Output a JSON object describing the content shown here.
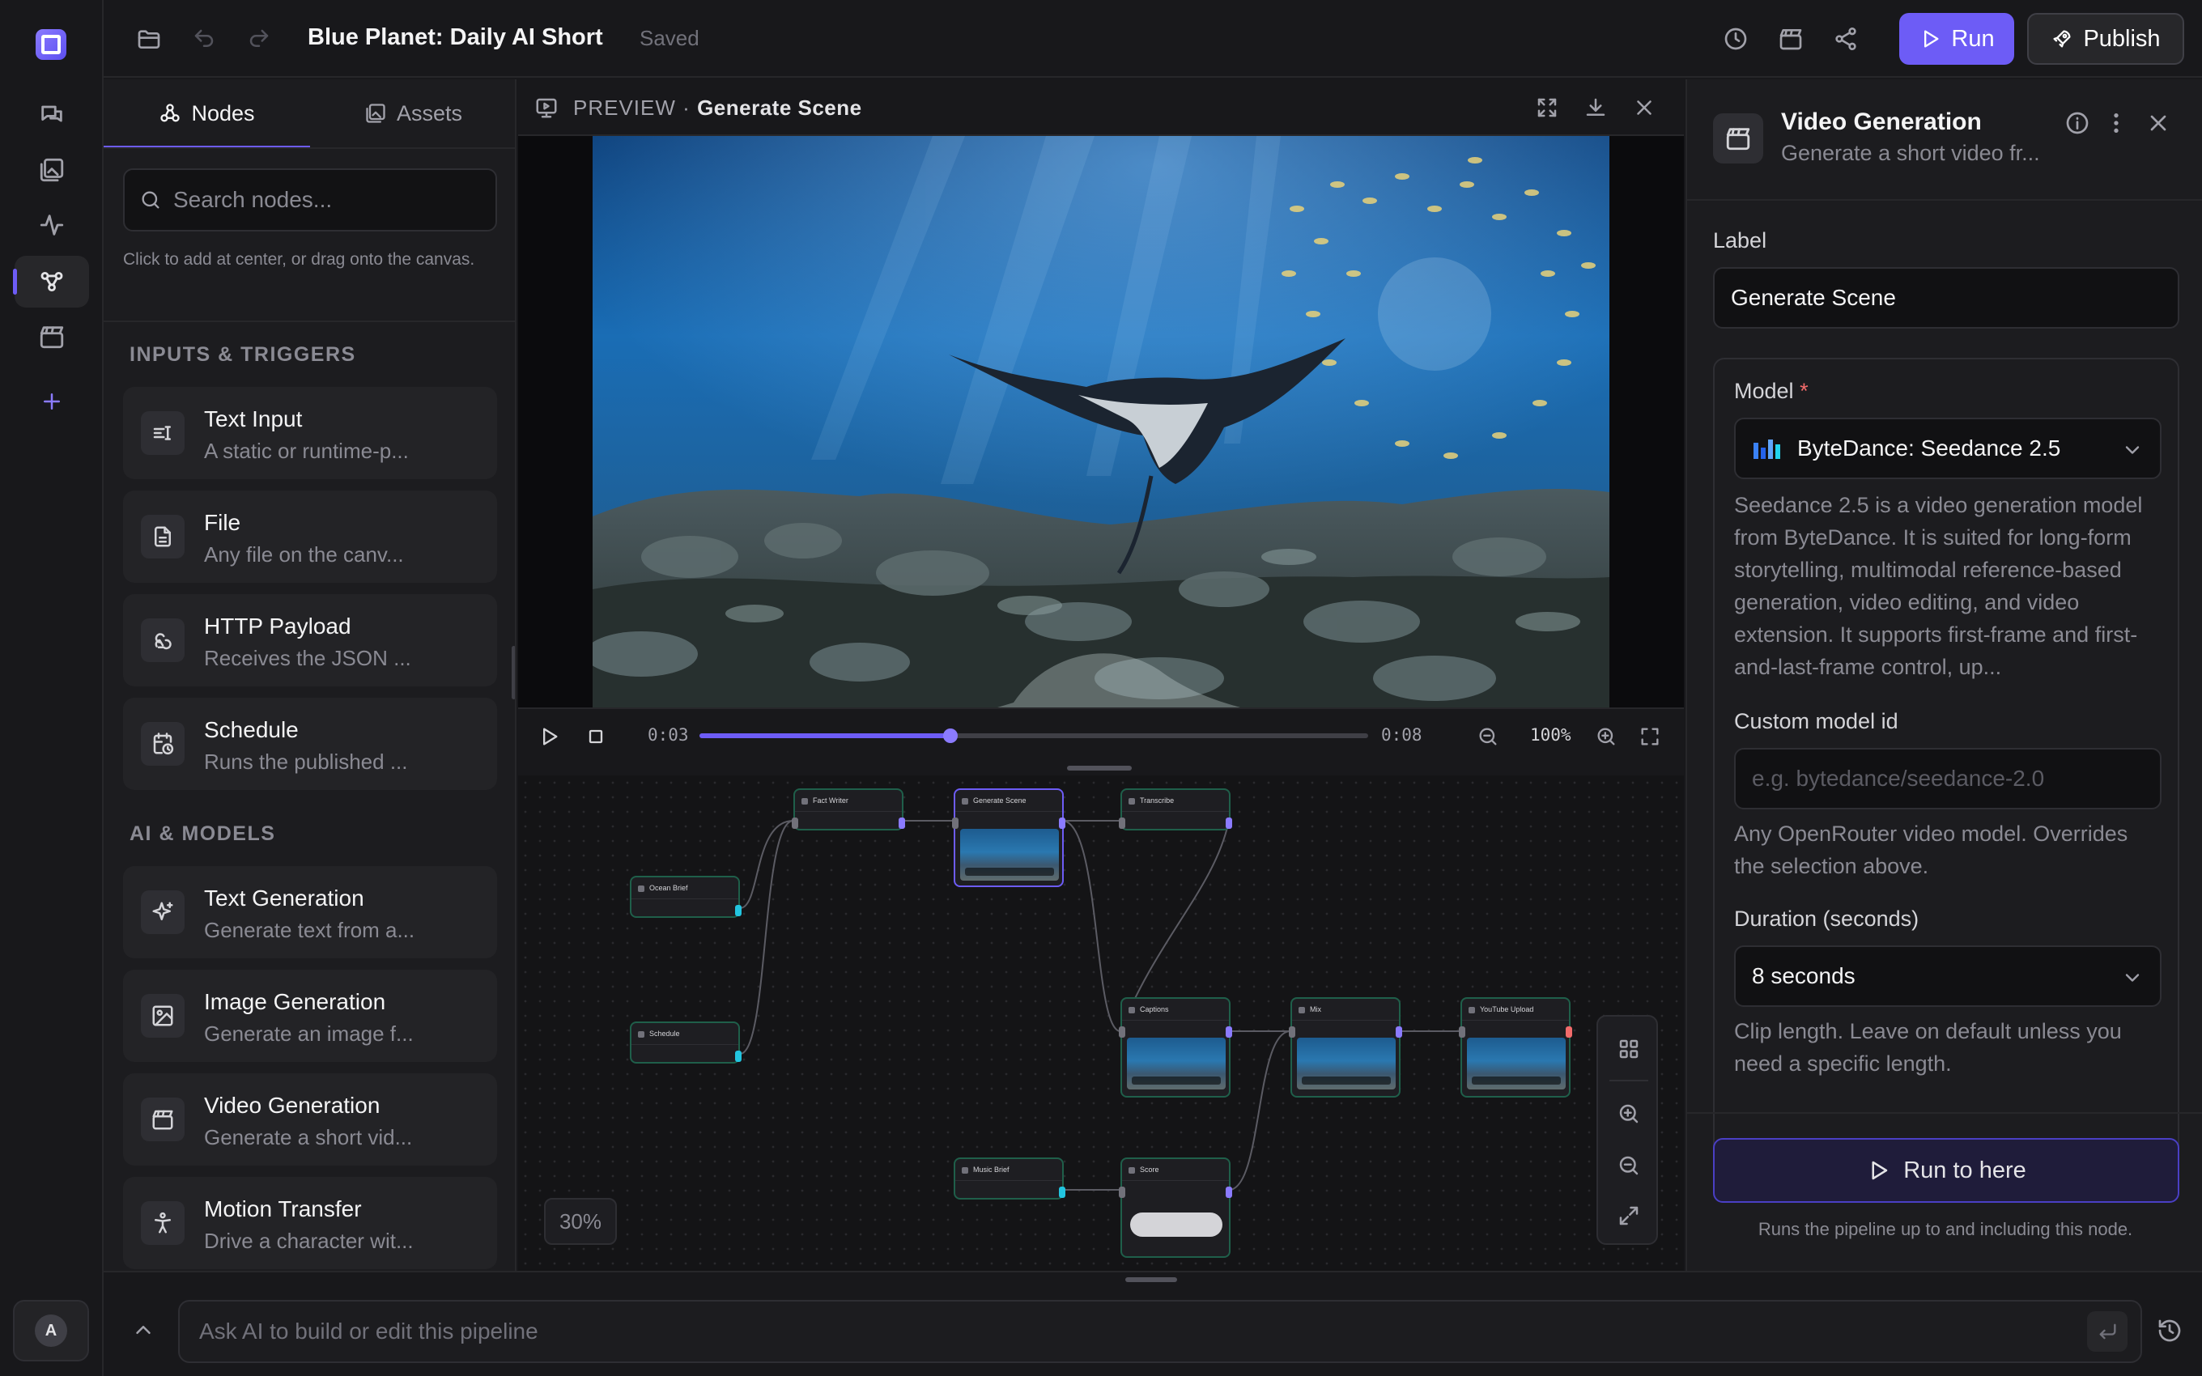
{
  "app": {
    "title": "Blue Planet: Daily AI Short",
    "save_status": "Saved",
    "run_label": "Run",
    "publish_label": "Publish",
    "avatar_initial": "A"
  },
  "left_panel": {
    "tabs": [
      {
        "label": "Nodes",
        "active": true
      },
      {
        "label": "Assets",
        "active": false
      }
    ],
    "search_placeholder": "Search nodes...",
    "hint": "Click to add at center, or drag onto the canvas.",
    "sections": [
      {
        "heading": "INPUTS & TRIGGERS",
        "items": [
          {
            "title": "Text Input",
            "desc": "A static or runtime-p...",
            "icon": "text-input-icon"
          },
          {
            "title": "File",
            "desc": "Any file on the canv...",
            "icon": "file-icon"
          },
          {
            "title": "HTTP Payload",
            "desc": "Receives the JSON ...",
            "icon": "webhook-icon"
          },
          {
            "title": "Schedule",
            "desc": "Runs the published ...",
            "icon": "calendar-clock-icon"
          }
        ]
      },
      {
        "heading": "AI & MODELS",
        "items": [
          {
            "title": "Text Generation",
            "desc": "Generate text from a...",
            "icon": "sparkles-icon"
          },
          {
            "title": "Image Generation",
            "desc": "Generate an image f...",
            "icon": "image-icon"
          },
          {
            "title": "Video Generation",
            "desc": "Generate a short vid...",
            "icon": "clapperboard-icon"
          },
          {
            "title": "Motion Transfer",
            "desc": "Drive a character wit...",
            "icon": "person-icon"
          }
        ]
      }
    ]
  },
  "preview": {
    "label": "PREVIEW",
    "separator": "·",
    "node_name": "Generate Scene",
    "current_time": "0:03",
    "duration": "0:08",
    "progress": 0.375,
    "zoom": "100%"
  },
  "canvas": {
    "zoom": "30%",
    "nodes": [
      {
        "title": "Fact Writer"
      },
      {
        "title": "Generate Scene"
      },
      {
        "title": "Transcribe"
      },
      {
        "title": "Ocean Brief"
      },
      {
        "title": "Schedule"
      },
      {
        "title": "Captions"
      },
      {
        "title": "Mix"
      },
      {
        "title": "YouTube Upload"
      },
      {
        "title": "Music Brief"
      },
      {
        "title": "Score"
      }
    ]
  },
  "inspector": {
    "title": "Video Generation",
    "subtitle": "Generate a short video fr...",
    "label_field": {
      "label": "Label",
      "value": "Generate Scene"
    },
    "model": {
      "label": "Model",
      "required_mark": "*",
      "value": "ByteDance: Seedance 2.5",
      "description": "Seedance 2.5 is a video generation model from ByteDance. It is suited for long-form storytelling, multimodal reference-based generation, video editing, and video extension. It supports first-frame and first-and-last-frame control, up..."
    },
    "custom_model": {
      "label": "Custom model id",
      "placeholder": "e.g. bytedance/seedance-2.0",
      "help": "Any OpenRouter video model. Overrides the selection above."
    },
    "duration": {
      "label": "Duration (seconds)",
      "value": "8 seconds",
      "help": "Clip length. Leave on default unless you need a specific length."
    },
    "run_here_label": "Run to here",
    "run_here_hint": "Runs the pipeline up to and including this node."
  },
  "assistant": {
    "placeholder": "Ask AI to build or edit this pipeline"
  },
  "colors": {
    "accent": "#6d5cf6",
    "background": "#18181b",
    "node_border": "#1f5f4a"
  }
}
